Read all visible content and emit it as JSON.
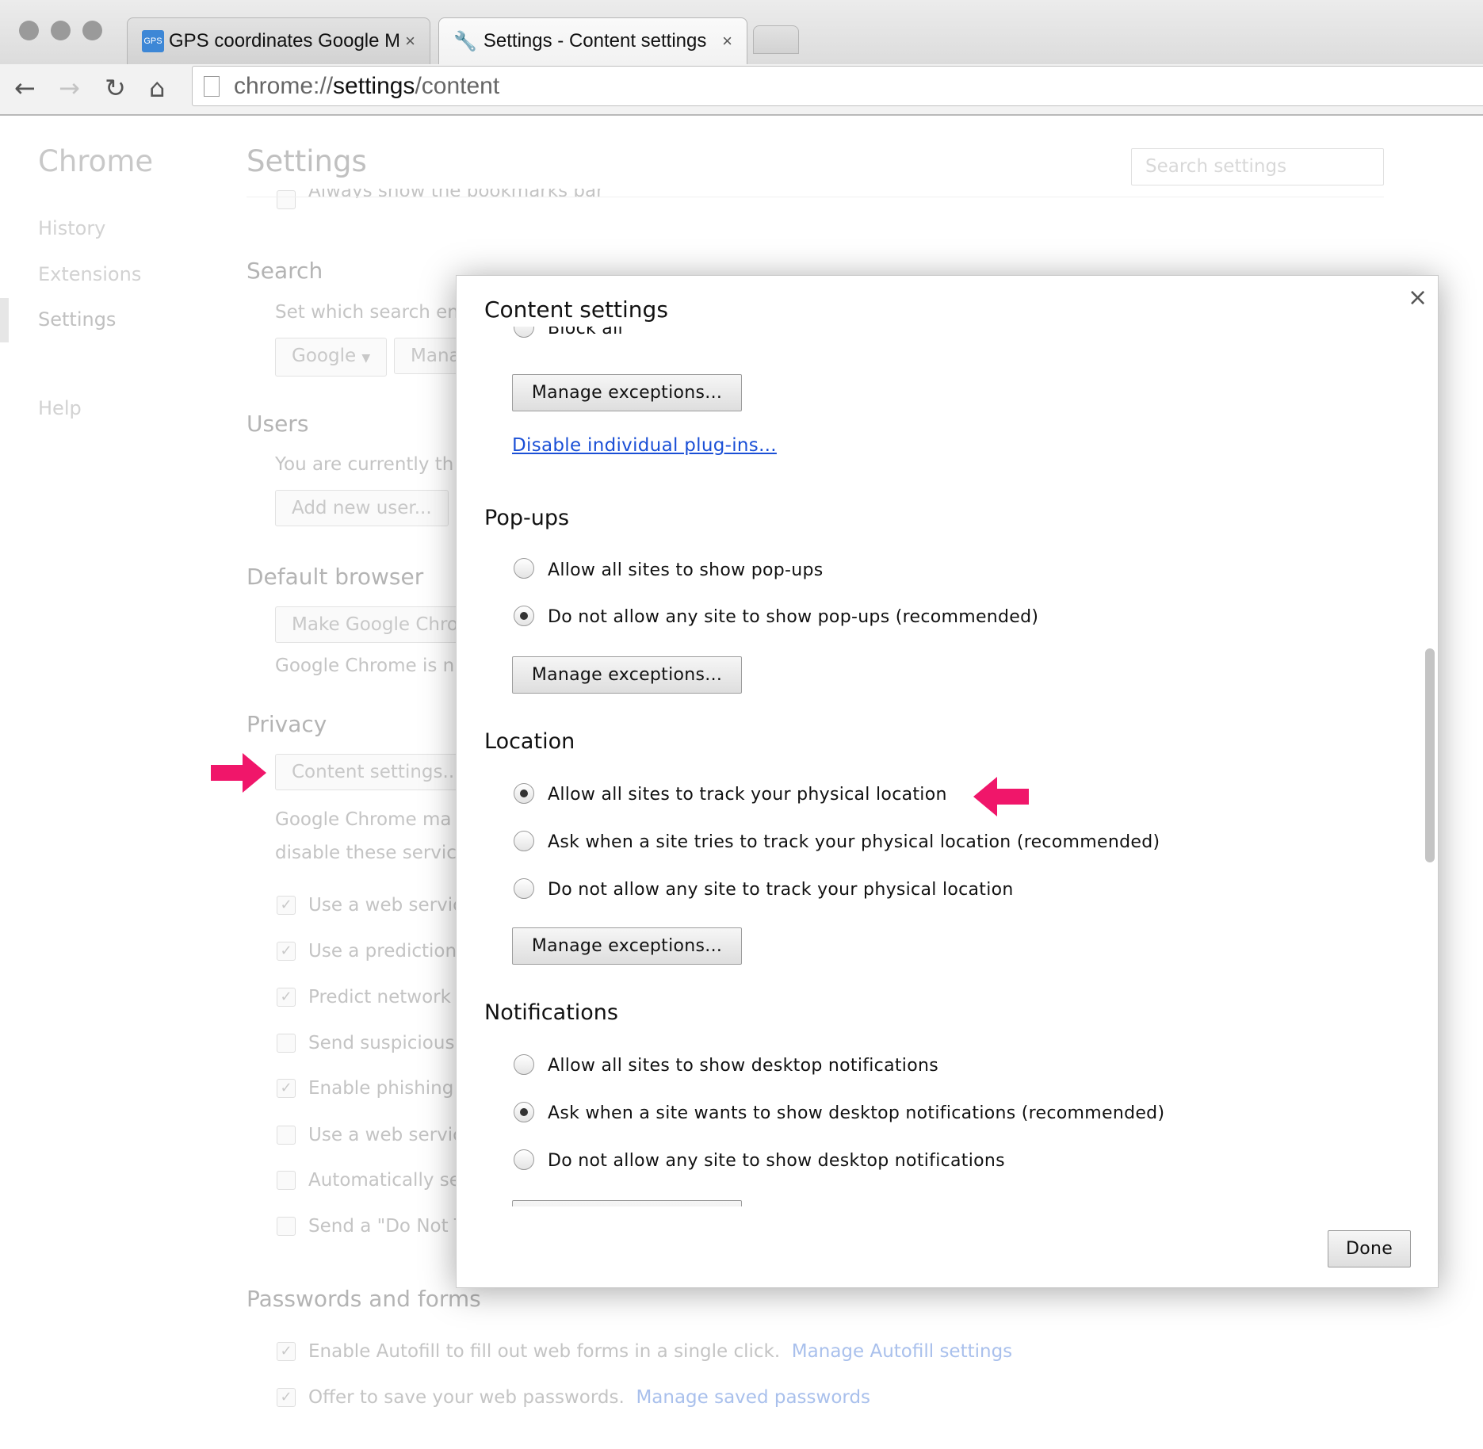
{
  "browser": {
    "tabs": [
      {
        "label": "GPS coordinates Google M",
        "favicon": "GPS",
        "active": false
      },
      {
        "label": "Settings - Content settings",
        "favicon": "wrench-icon",
        "active": true
      }
    ],
    "close_glyph": "×",
    "url_prefix": "chrome://",
    "url_host": "settings",
    "url_path": "/content"
  },
  "sidebar": {
    "title": "Chrome",
    "items": [
      {
        "label": "History"
      },
      {
        "label": "Extensions"
      },
      {
        "label": "Settings",
        "selected": true
      },
      {
        "label": "Help"
      }
    ]
  },
  "settings": {
    "title": "Settings",
    "search_placeholder": "Search settings",
    "bookmarks_bar": "Always show the bookmarks bar",
    "search": {
      "heading": "Search",
      "text": "Set which search en",
      "engine": "Google",
      "manage": "Mana"
    },
    "users": {
      "heading": "Users",
      "text": "You are currently th",
      "add": "Add new user..."
    },
    "default_browser": {
      "heading": "Default browser",
      "button": "Make Google Chro",
      "text": "Google Chrome is n"
    },
    "privacy": {
      "heading": "Privacy",
      "button": "Content settings...",
      "text1": "Google Chrome ma",
      "text2": "disable these servic",
      "checks": [
        {
          "label": "Use a web servic",
          "checked": true
        },
        {
          "label": "Use a prediction",
          "checked": true
        },
        {
          "label": "Predict network",
          "checked": true
        },
        {
          "label": "Send suspicious",
          "checked": false
        },
        {
          "label": "Enable phishing",
          "checked": true
        },
        {
          "label": "Use a web servic",
          "checked": false
        },
        {
          "label": "Automatically se",
          "checked": false
        },
        {
          "label": "Send a \"Do Not T",
          "checked": false
        }
      ]
    },
    "passwords": {
      "heading": "Passwords and forms",
      "autofill": "Enable Autofill to fill out web forms in a single click.",
      "autofill_link": "Manage Autofill settings",
      "save": "Offer to save your web passwords.",
      "save_link": "Manage saved passwords"
    }
  },
  "dialog": {
    "title": "Content settings",
    "close_glyph": "×",
    "block_all": "Block all",
    "manage_exceptions": "Manage exceptions...",
    "plugins_link": "Disable individual plug-ins...",
    "popups": {
      "heading": "Pop-ups",
      "options": [
        {
          "label": "Allow all sites to show pop-ups",
          "selected": false
        },
        {
          "label": "Do not allow any site to show pop-ups (recommended)",
          "selected": true
        }
      ]
    },
    "location": {
      "heading": "Location",
      "options": [
        {
          "label": "Allow all sites to track your physical location",
          "selected": true
        },
        {
          "label": "Ask when a site tries to track your physical location (recommended)",
          "selected": false
        },
        {
          "label": "Do not allow any site to track your physical location",
          "selected": false
        }
      ]
    },
    "notifications": {
      "heading": "Notifications",
      "options": [
        {
          "label": "Allow all sites to show desktop notifications",
          "selected": false
        },
        {
          "label": "Ask when a site wants to show desktop notifications (recommended)",
          "selected": true
        },
        {
          "label": "Do not allow any site to show desktop notifications",
          "selected": false
        }
      ]
    },
    "done": "Done"
  },
  "colors": {
    "annotation_arrow": "#f0166a",
    "link": "#1a4fd6"
  }
}
